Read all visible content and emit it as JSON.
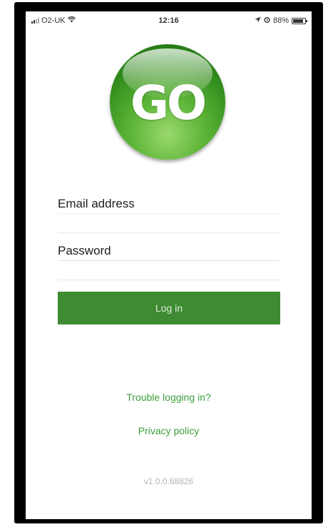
{
  "status_bar": {
    "carrier": "O2-UK",
    "time": "12:16",
    "battery_text": "88%",
    "battery_level": 0.88
  },
  "logo": {
    "text": "GO",
    "color": "#4aa82f"
  },
  "form": {
    "email_label": "Email address",
    "email_value": "",
    "password_label": "Password",
    "password_value": "",
    "login_label": "Log in"
  },
  "links": {
    "trouble": "Trouble logging in?",
    "privacy": "Privacy policy"
  },
  "version": "v1.0.0.68826",
  "colors": {
    "primary_button": "#3f8b33",
    "link": "#3e9d3c"
  },
  "icons": [
    "signal-icon",
    "wifi-icon",
    "location-arrow-icon",
    "alarm-icon",
    "battery-icon"
  ]
}
